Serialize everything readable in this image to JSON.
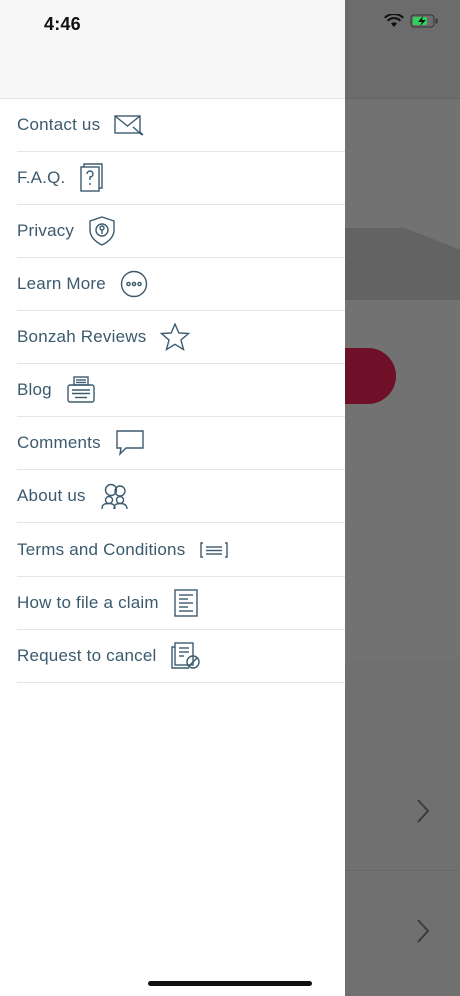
{
  "status_bar": {
    "time": "4:46"
  },
  "menu": {
    "items": [
      {
        "label": "Contact us",
        "icon": "envelope-icon"
      },
      {
        "label": "F.A.Q.",
        "icon": "question-document-icon"
      },
      {
        "label": "Privacy",
        "icon": "shield-icon"
      },
      {
        "label": "Learn More",
        "icon": "more-circle-icon"
      },
      {
        "label": "Bonzah Reviews",
        "icon": "star-icon"
      },
      {
        "label": "Blog",
        "icon": "typewriter-icon"
      },
      {
        "label": "Comments",
        "icon": "speech-bubble-icon"
      },
      {
        "label": "About us",
        "icon": "people-icon"
      },
      {
        "label": "Terms and Conditions",
        "icon": "text-lines-icon"
      },
      {
        "label": "How to file a claim",
        "icon": "form-document-icon"
      },
      {
        "label": "Request to cancel",
        "icon": "cancel-document-icon"
      }
    ]
  },
  "colors": {
    "menu_text": "#3b5a6e",
    "accent_button": "#6e1128",
    "battery_green": "#30d158"
  }
}
